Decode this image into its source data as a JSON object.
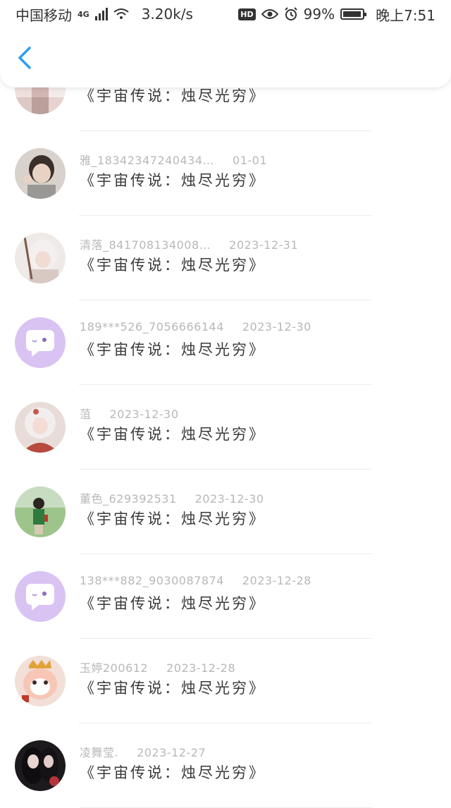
{
  "status_bar": {
    "carrier": "中国移动",
    "network": "4G",
    "speed": "3.20k/s",
    "hd": "HD",
    "battery": "99%",
    "time": "晚上7:51"
  },
  "header": {
    "back_icon": "chevron-left-icon",
    "accent_color": "#2a9ef5"
  },
  "comments": [
    {
      "user": "",
      "date": "",
      "text": "《宇宙传说：烛尽光穷》",
      "avatar": "collage"
    },
    {
      "user": "雅_18342347240434…",
      "date": "01-01",
      "text": "《宇宙传说：烛尽光穷》",
      "avatar": "photo"
    },
    {
      "user": "清落_841708134008…",
      "date": "2023-12-31",
      "text": "《宇宙传说：烛尽光穷》",
      "avatar": "photo"
    },
    {
      "user": "189***526_7056666144",
      "date": "2023-12-30",
      "text": "《宇宙传说：烛尽光穷》",
      "avatar": "default-chat"
    },
    {
      "user": "菹",
      "date": "2023-12-30",
      "text": "《宇宙传说：烛尽光穷》",
      "avatar": "photo"
    },
    {
      "user": "董色_629392531",
      "date": "2023-12-30",
      "text": "《宇宙传说：烛尽光穷》",
      "avatar": "photo"
    },
    {
      "user": "138***882_9030087874",
      "date": "2023-12-28",
      "text": "《宇宙传说：烛尽光穷》",
      "avatar": "default-chat"
    },
    {
      "user": "玉婷200612",
      "date": "2023-12-28",
      "text": "《宇宙传说：烛尽光穷》",
      "avatar": "photo"
    },
    {
      "user": "凌舞莹.",
      "date": "2023-12-27",
      "text": "《宇宙传说：烛尽光穷》",
      "avatar": "photo"
    }
  ]
}
